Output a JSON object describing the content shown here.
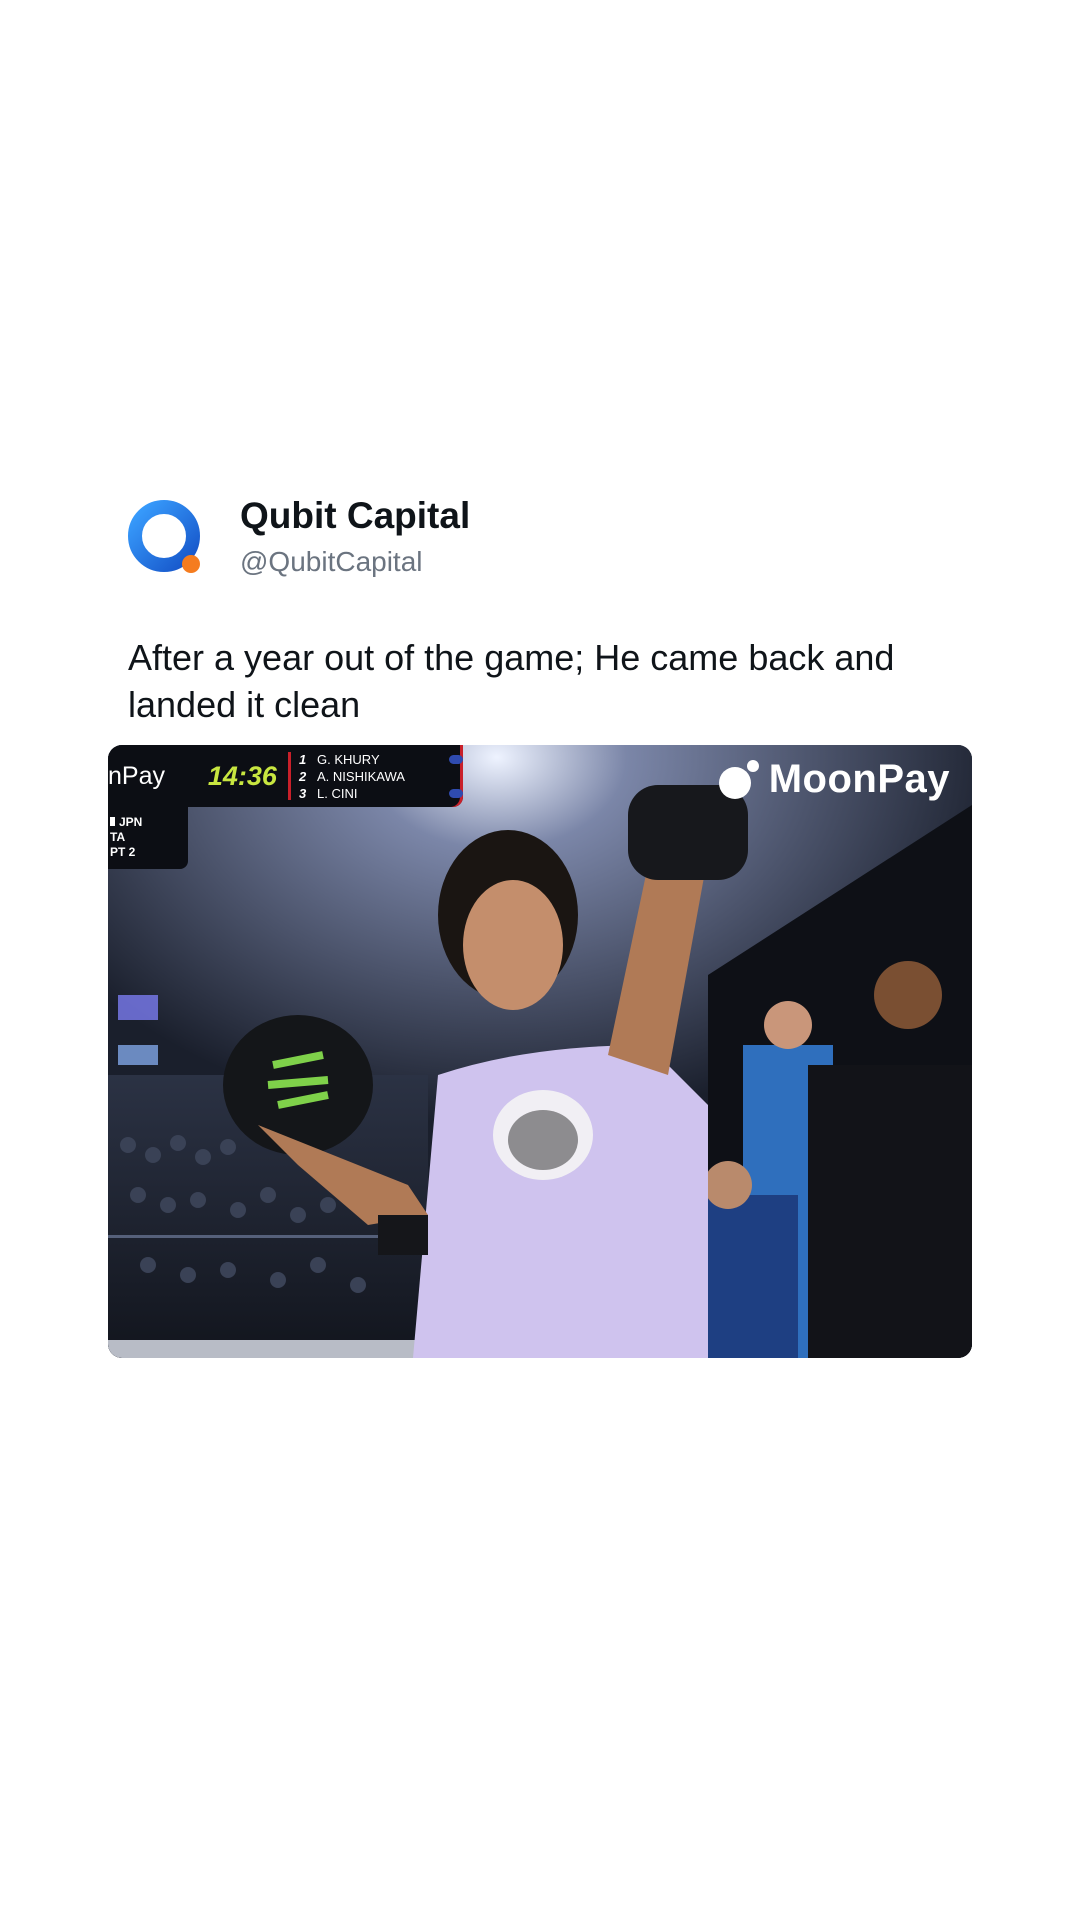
{
  "post": {
    "author": {
      "display_name": "Qubit Capital",
      "handle": "@QubitCapital",
      "avatar_icon": "qubit-logo-icon",
      "avatar_colors": {
        "ring": "#1a6fe0",
        "dot": "#f57c1f"
      }
    },
    "text": "After a year out of the game; He came back and landed it clean"
  },
  "media": {
    "scoreboard": {
      "sponsor": "nPay",
      "clock": "14:36",
      "standings": [
        {
          "rank": "1",
          "name": "G. KHURY"
        },
        {
          "rank": "2",
          "name": "A. NISHIKAWA"
        },
        {
          "rank": "3",
          "name": "L. CINI"
        }
      ],
      "subpanel": [
        "JPN",
        "TA",
        "PT 2"
      ]
    },
    "brand": {
      "text": "MoonPay",
      "icon": "moonpay-logo-icon"
    },
    "description_icon": "skater-holding-helmet-photo"
  }
}
